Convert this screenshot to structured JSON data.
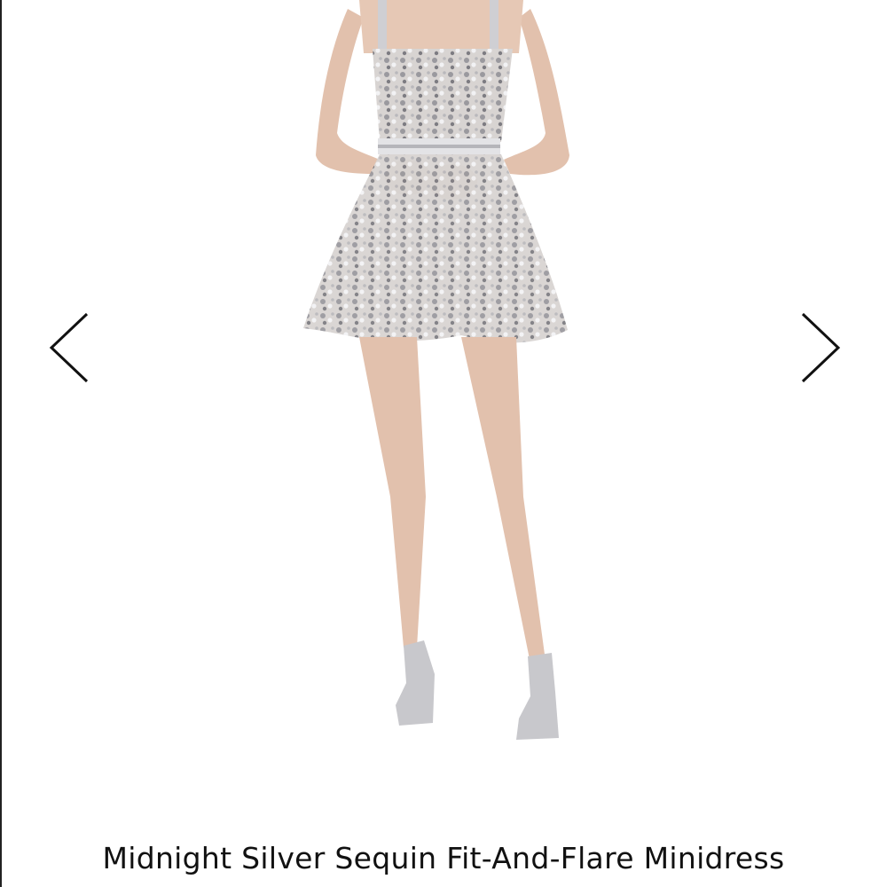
{
  "product": {
    "title": "Midnight Silver Sequin Fit-And-Flare Minidress"
  },
  "gallery": {
    "prev_icon": "chevron-left-icon",
    "next_icon": "chevron-right-icon"
  },
  "colors": {
    "arrow": "#111111",
    "dress": "#c9c6c4",
    "skin": "#e2c1ad",
    "sequin": "#8d8d92"
  }
}
